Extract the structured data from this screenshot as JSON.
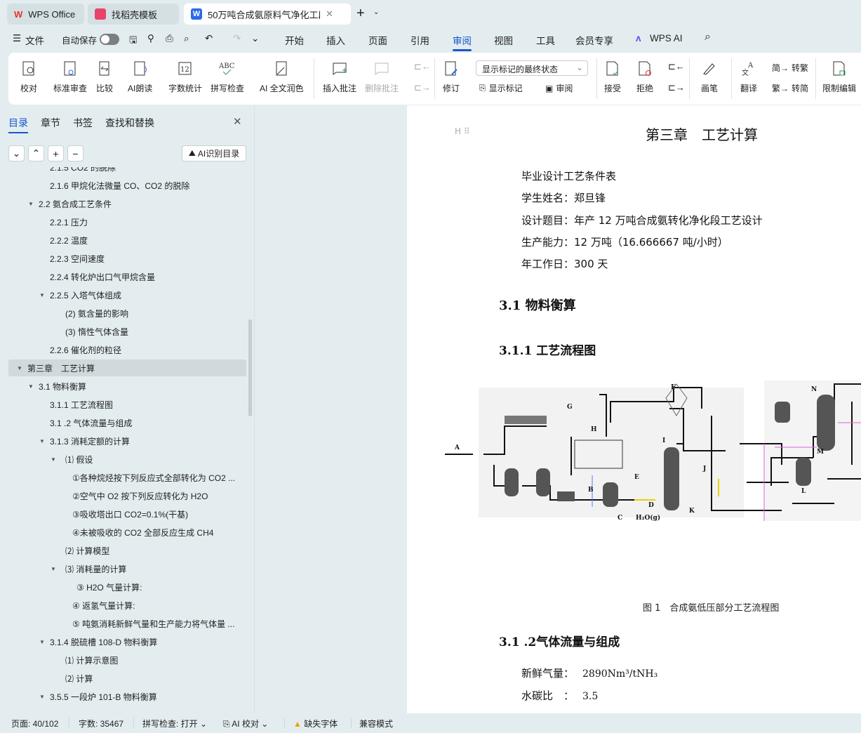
{
  "tabs": [
    {
      "label": "WPS Office"
    },
    {
      "label": "找稻壳模板"
    },
    {
      "label": "50万吨合成氨原料气净化工段"
    }
  ],
  "menu": {
    "file": "文件",
    "autosave": "自动保存",
    "items": [
      "开始",
      "插入",
      "页面",
      "引用",
      "审阅",
      "视图",
      "工具",
      "会员专享",
      "WPS AI"
    ],
    "active": "审阅"
  },
  "ribbon": {
    "buttons": [
      "校对",
      "标准审查",
      "比较",
      "AI朗读",
      "字数统计",
      "拼写检查",
      "AI 全文润色",
      "插入批注",
      "删除批注",
      "修订",
      "接受",
      "拒绝",
      "画笔",
      "翻译",
      "限制编辑"
    ],
    "display_select": "显示标记的最终状态",
    "show_marks": "显示标记",
    "review": "审阅",
    "to_trad": "转繁",
    "to_simp": "转简"
  },
  "nav": {
    "tabs": [
      "目录",
      "章节",
      "书签",
      "查找和替换"
    ],
    "ai_toc": "AI识别目录",
    "items": [
      {
        "t": "2.1.5 CO2 的脱除",
        "lv": 2
      },
      {
        "t": "2.1.6 甲烷化法微量 CO、CO2 的脱除",
        "lv": 2
      },
      {
        "t": "2.2 氨合成工艺条件",
        "lv": 1,
        "exp": true
      },
      {
        "t": "2.2.1 压力",
        "lv": 2
      },
      {
        "t": "2.2.2 温度",
        "lv": 2
      },
      {
        "t": "2.2.3 空间速度",
        "lv": 2
      },
      {
        "t": "2.2.4 转化炉出口气甲烷含量",
        "lv": 2
      },
      {
        "t": "2.2.5 入塔气体组成",
        "lv": 2,
        "exp": true
      },
      {
        "t": "(2) 氨含量的影响",
        "lv": 3
      },
      {
        "t": "(3) 惰性气体含量",
        "lv": 3
      },
      {
        "t": "2.2.6 催化剂的粒径",
        "lv": 2
      },
      {
        "t": "第三章　工艺计算",
        "lv": 0,
        "exp": true,
        "sel": true
      },
      {
        "t": "3.1 物料衡算",
        "lv": 1,
        "exp": true
      },
      {
        "t": "3.1.1 工艺流程图",
        "lv": 2
      },
      {
        "t": "3.1 .2 气体流量与组成",
        "lv": 2
      },
      {
        "t": "3.1.3 消耗定额的计算",
        "lv": 2,
        "exp": true
      },
      {
        "t": "⑴ 假设",
        "lv": 3,
        "exp": true
      },
      {
        "t": "①各种烷烃按下列反应式全部转化为 CO2 ...",
        "lv": 4
      },
      {
        "t": "②空气中 O2 按下列反应转化为 H2O",
        "lv": 4
      },
      {
        "t": "③吸收塔出口 CO2=0.1%(干基)",
        "lv": 4
      },
      {
        "t": "④未被吸收的 CO2 全部反应生成 CH4",
        "lv": 4
      },
      {
        "t": "⑵ 计算模型",
        "lv": 3
      },
      {
        "t": "⑶ 消耗量的计算",
        "lv": 3,
        "exp": true
      },
      {
        "t": "③ H2O 气量计算:",
        "lv": 4.4
      },
      {
        "t": "④ 返氢气量计算:",
        "lv": 4
      },
      {
        "t": "⑤ 吨氨消耗新鲜气量和生产能力将气体量 ...",
        "lv": 4
      },
      {
        "t": "3.1.4 脱硫槽 108-D 物料衡算",
        "lv": 2,
        "exp": true
      },
      {
        "t": "⑴ 计算示意图",
        "lv": 3
      },
      {
        "t": "⑵ 计算",
        "lv": 3
      },
      {
        "t": "3.5.5 一段炉 101-B 物料衡算",
        "lv": 2,
        "exp": true
      }
    ]
  },
  "doc": {
    "chapter": "第三章　工艺计算",
    "lines": [
      "毕业设计工艺条件表",
      "学生姓名：郑旦锋",
      "设计题目：年产 12 万吨合成氨转化净化段工艺设计",
      "生产能力：12 万吨（16.666667 吨/小时）",
      "年工作日：300 天"
    ],
    "h31": "3.1  物料衡算",
    "h311": "3.1.1  工艺流程图",
    "figure_letters": [
      "A",
      "B",
      "C",
      "D",
      "E",
      "F",
      "G",
      "H",
      "I",
      "J",
      "K",
      "L",
      "M",
      "N"
    ],
    "figure_h2o": "H₂O(g)",
    "caption": "图 1　合成氨低压部分工艺流程图",
    "h312": "3.1 .2气体流量与组成",
    "fresh_label": "新鲜气量：",
    "fresh_value": "2890Nm³/tNH₃",
    "wc_label": "水碳比　：",
    "wc_value": "3.5"
  },
  "status": {
    "page": "页面: 40/102",
    "words": "字数: 35467",
    "spell": "拼写检查: 打开",
    "ai": "AI 校对",
    "font": "缺失字体",
    "compat": "兼容模式"
  },
  "colors": {
    "accent": "#1a56c9",
    "wps_red": "#e8342a"
  }
}
